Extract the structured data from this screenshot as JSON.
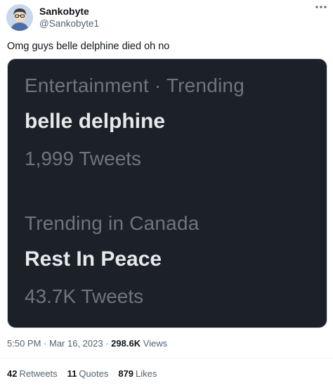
{
  "author": {
    "name": "Sankobyte",
    "handle": "@Sankobyte1"
  },
  "tweet": {
    "text": "Omg guys belle delphine died oh no"
  },
  "media": {
    "trends": [
      {
        "category": "Entertainment · Trending",
        "name": "belle delphine",
        "count": "1,999 Tweets"
      },
      {
        "category": "Trending in Canada",
        "name": "Rest In Peace",
        "count": "43.7K Tweets"
      }
    ]
  },
  "meta": {
    "time": "5:50 PM",
    "date": "Mar 16, 2023",
    "views_count": "298.6K",
    "views_label": "Views",
    "separator": " · "
  },
  "stats": {
    "retweets_count": "42",
    "retweets_label": "Retweets",
    "quotes_count": "11",
    "quotes_label": "Quotes",
    "likes_count": "879",
    "likes_label": "Likes"
  },
  "icons": {
    "more": "more-horizontal-icon"
  },
  "colors": {
    "card_bg": "#1c2028",
    "secondary_text": "#536471",
    "primary_text": "#0f1419"
  }
}
